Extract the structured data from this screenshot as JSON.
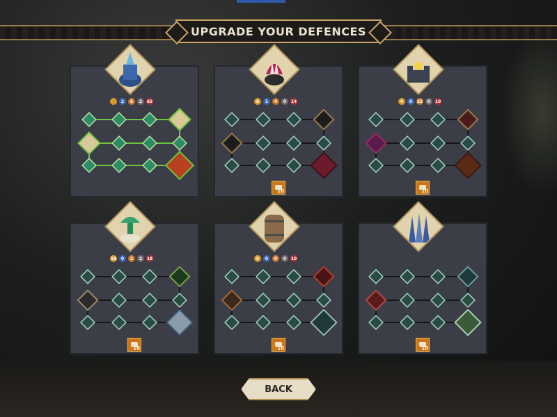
{
  "header": {
    "title": "UPGRADE YOUR DEFENCES"
  },
  "footer": {
    "back_label": "BACK"
  },
  "colors": {
    "accent_gold": "#c9a565",
    "unlock_green": "#6ec23c",
    "panel_bg": "#3b3d47"
  },
  "defences": [
    {
      "id": "spire",
      "stats": [
        {
          "icon": "coin",
          "color": "#d59a2b",
          "value": ""
        },
        {
          "icon": "range",
          "color": "#3e64b8",
          "value": "2"
        },
        {
          "icon": "speed",
          "color": "#c9772c",
          "value": "6"
        },
        {
          "icon": "slots",
          "color": "#6e6e6e",
          "value": "2"
        },
        {
          "icon": "damage",
          "color": "#b32e2e",
          "value": "65"
        }
      ],
      "cost": "",
      "unlocked": true
    },
    {
      "id": "bear-trap",
      "stats": [
        {
          "icon": "coin",
          "color": "#d59a2b",
          "value": "6"
        },
        {
          "icon": "range",
          "color": "#3e64b8",
          "value": "1"
        },
        {
          "icon": "speed",
          "color": "#c9772c",
          "value": "4"
        },
        {
          "icon": "slots",
          "color": "#6e6e6e",
          "value": "0"
        },
        {
          "icon": "damage",
          "color": "#b32e2e",
          "value": "14"
        }
      ],
      "cost": "10",
      "unlocked": false
    },
    {
      "id": "wall",
      "stats": [
        {
          "icon": "coin",
          "color": "#d59a2b",
          "value": "4"
        },
        {
          "icon": "range",
          "color": "#3e64b8",
          "value": "0"
        },
        {
          "icon": "speed",
          "color": "#c9772c",
          "value": "25"
        },
        {
          "icon": "slots",
          "color": "#6e6e6e",
          "value": "0"
        },
        {
          "icon": "damage",
          "color": "#b32e2e",
          "value": "10"
        }
      ],
      "cost": "10",
      "unlocked": false
    },
    {
      "id": "poison-tower",
      "stats": [
        {
          "icon": "coin",
          "color": "#d59a2b",
          "value": "16"
        },
        {
          "icon": "range",
          "color": "#3e64b8",
          "value": "0"
        },
        {
          "icon": "speed",
          "color": "#c9772c",
          "value": "2"
        },
        {
          "icon": "slots",
          "color": "#6e6e6e",
          "value": "2"
        },
        {
          "icon": "damage",
          "color": "#b32e2e",
          "value": "18"
        }
      ],
      "cost": "10",
      "unlocked": false
    },
    {
      "id": "barrel",
      "stats": [
        {
          "icon": "coin",
          "color": "#d59a2b",
          "value": "5"
        },
        {
          "icon": "range",
          "color": "#3e64b8",
          "value": "0"
        },
        {
          "icon": "speed",
          "color": "#c9772c",
          "value": "0"
        },
        {
          "icon": "slots",
          "color": "#6e6e6e",
          "value": "0"
        },
        {
          "icon": "damage",
          "color": "#b32e2e",
          "value": "10"
        }
      ],
      "cost": "10",
      "unlocked": false
    },
    {
      "id": "spikes",
      "stats": [],
      "cost": "10",
      "unlocked": false
    }
  ]
}
